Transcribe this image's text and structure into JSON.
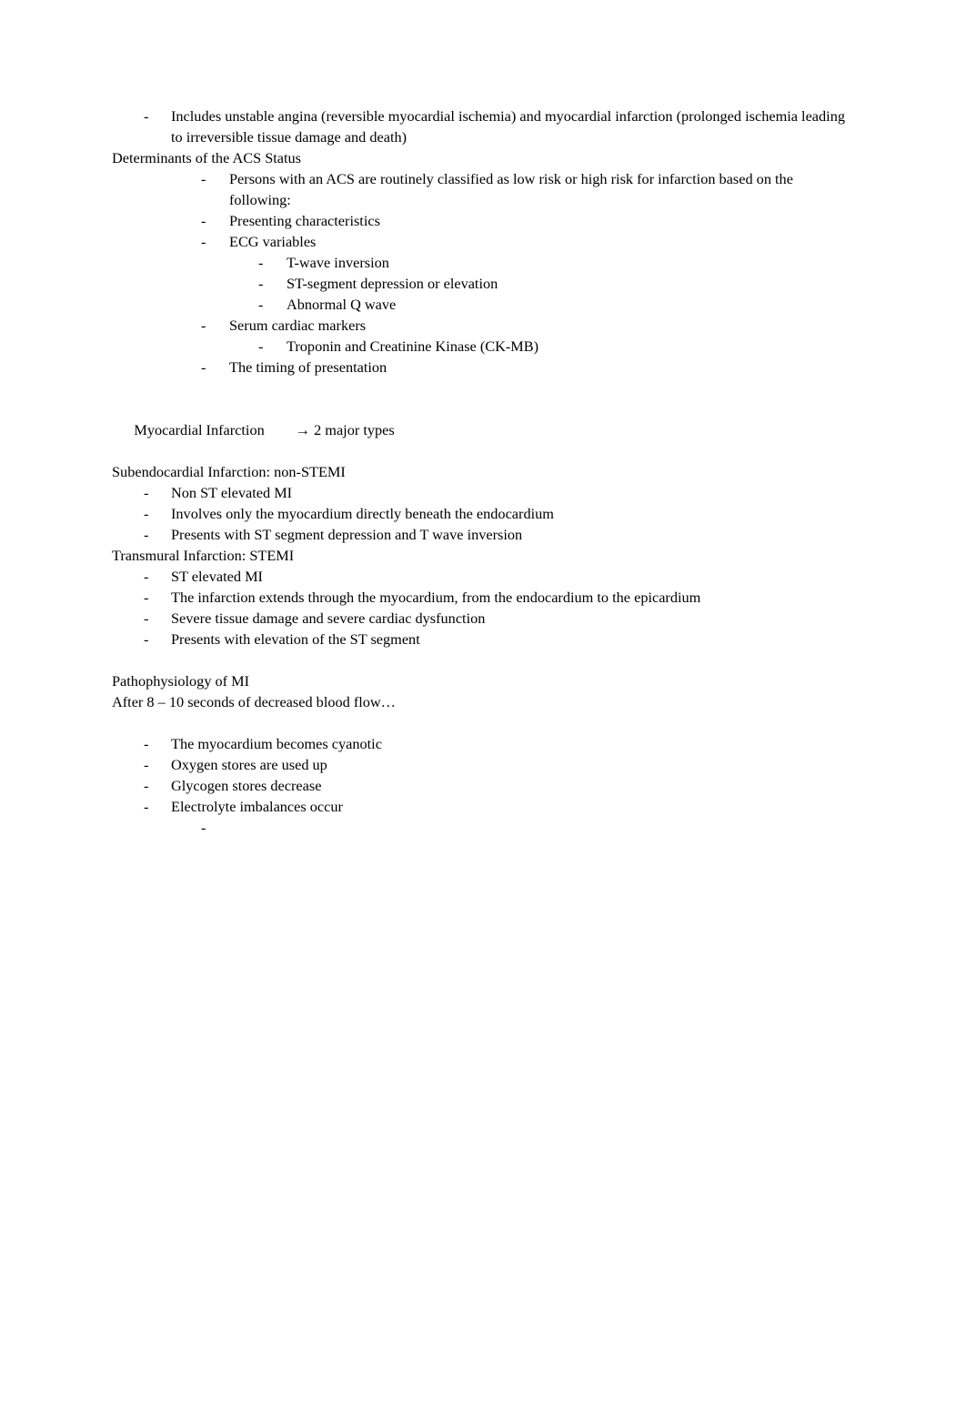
{
  "document": {
    "page_background": "#ffffff",
    "text_color": "#000000",
    "blocks": [
      {
        "id": "acs-intro",
        "lines": [
          {
            "level": 1,
            "bullet": "-",
            "text": "Includes unstable angina (reversible myocardial ischemia) and myocardial infarction (prolonged ischemia leading to irreversible tissue damage and death)"
          }
        ]
      },
      {
        "id": "determinants",
        "heading": "Determinants of the ACS Status",
        "lines": [
          {
            "level": 2,
            "bullet": "-",
            "text": "Persons with an ACS are routinely classified as low risk or high risk for infarction based on the following:"
          },
          {
            "level": 2,
            "bullet": "-",
            "text": "Presenting characteristics"
          },
          {
            "level": 2,
            "bullet": "-",
            "text": "ECG variables"
          },
          {
            "level": 3,
            "bullet": "-",
            "text": "T-wave inversion"
          },
          {
            "level": 3,
            "bullet": "-",
            "text": "ST-segment depression or elevation"
          },
          {
            "level": 3,
            "bullet": "-",
            "text": "Abnormal Q wave"
          },
          {
            "level": 2,
            "bullet": "-",
            "text": "Serum cardiac markers"
          },
          {
            "level": 3,
            "bullet": "-",
            "text": "Troponin and Creatinine Kinase (CK-MB)"
          },
          {
            "level": 2,
            "bullet": "-",
            "text": "The timing of presentation"
          }
        ]
      },
      {
        "id": "mi-types",
        "heading_prefix": "Myocardial Infarction",
        "heading_arrow": "→ 2 major types",
        "subheading_nstemi": "Subendocardial Infarction: non-STEMI",
        "nstemi_lines": [
          {
            "level": 1,
            "bullet": "-",
            "text": "Non ST elevated MI"
          },
          {
            "level": 1,
            "bullet": "-",
            "text": "Involves only the myocardium directly beneath the endocardium"
          },
          {
            "level": 1,
            "bullet": "-",
            "text": "Presents with ST segment depression and T wave inversion"
          }
        ],
        "subheading_stemi": "Transmural Infarction: STEMI",
        "stemi_lines": [
          {
            "level": 1,
            "bullet": "-",
            "text": "ST elevated MI"
          },
          {
            "level": 1,
            "bullet": "-",
            "text": "The infarction extends through the myocardium, from the endocardium to the epicardium"
          },
          {
            "level": 1,
            "bullet": "-",
            "text": "Severe tissue damage and severe cardiac dysfunction"
          },
          {
            "level": 1,
            "bullet": "-",
            "text": "Presents with elevation of the ST segment"
          }
        ]
      },
      {
        "id": "pathophysiology",
        "heading": "Pathophysiology of MI",
        "subheading": "After 8 – 10 seconds of decreased blood flow…",
        "lines": [
          {
            "level": 1,
            "bullet": "-",
            "text": "The myocardium becomes cyanotic"
          },
          {
            "level": 1,
            "bullet": "-",
            "text": "Oxygen stores are used up"
          },
          {
            "level": 1,
            "bullet": "-",
            "text": "Glycogen stores decrease"
          },
          {
            "level": 1,
            "bullet": "-",
            "text": "Electrolyte imbalances occur"
          },
          {
            "level": 2,
            "bullet": "-",
            "text": ""
          }
        ]
      }
    ]
  }
}
